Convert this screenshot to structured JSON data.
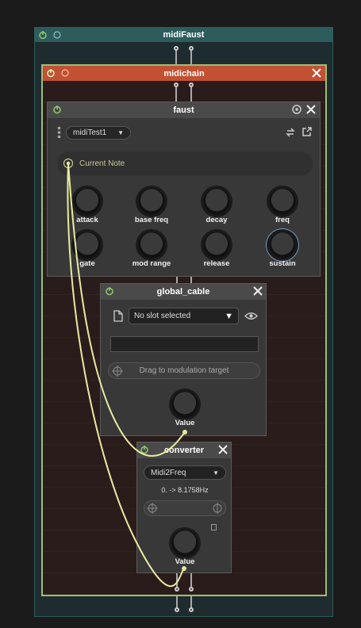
{
  "outer": {
    "title": "midiFaust"
  },
  "chain": {
    "title": "midichain"
  },
  "faust": {
    "title": "faust",
    "dropdown": "midiTest1",
    "current_note": "Current Note",
    "knobs": [
      "attack",
      "base freq",
      "decay",
      "freq",
      "gate",
      "mod range",
      "release",
      "sustain"
    ]
  },
  "global_cable": {
    "title": "global_cable",
    "slot": "No slot selected",
    "drag_target": "Drag to modulation target",
    "knob": "Value"
  },
  "converter": {
    "title": "converter",
    "mode": "Midi2Freq",
    "range": "0. -> 8.1758Hz",
    "knob": "Value"
  },
  "colors": {
    "accent_green": "#8ec56a",
    "chain_header": "#c25032",
    "outer_header": "#2d5c5c",
    "cable": "#e8eba0"
  },
  "icons": [
    "power-icon",
    "close-icon",
    "menu-dots-icon",
    "swap-icon",
    "external-link-icon",
    "document-icon",
    "eye-icon",
    "crosshair-icon"
  ]
}
